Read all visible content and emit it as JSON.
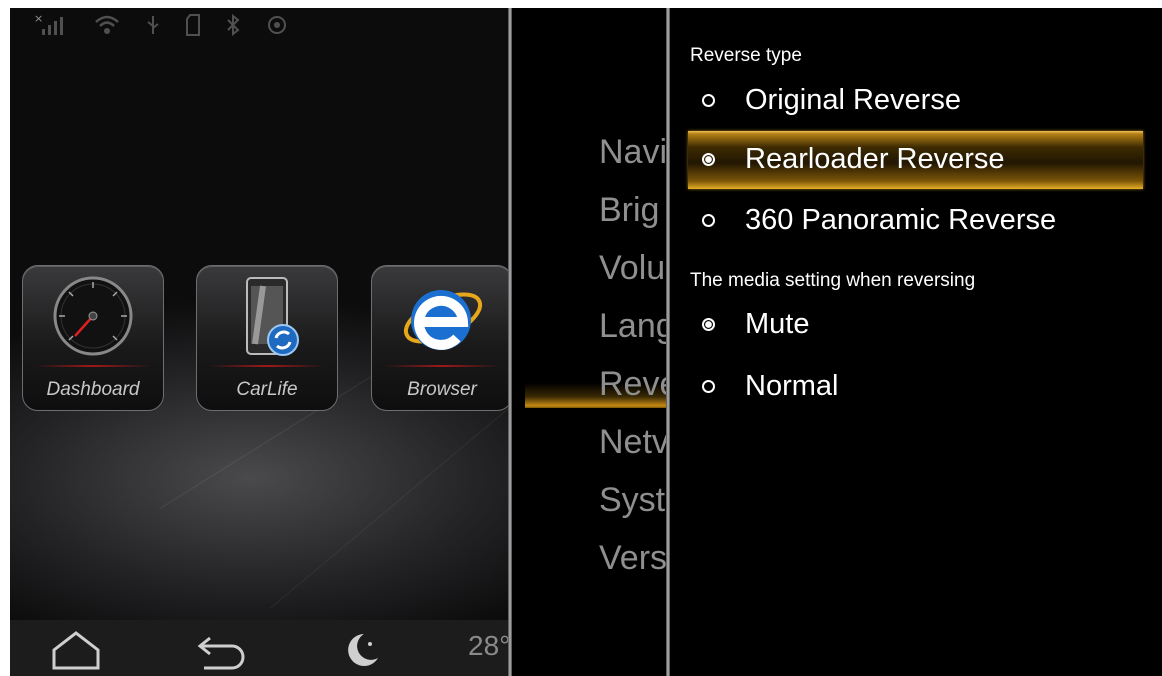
{
  "launcher": {
    "apps": [
      {
        "label": "Dashboard",
        "icon": "speedometer-icon"
      },
      {
        "label": "CarLife",
        "icon": "carlife-phone-icon"
      },
      {
        "label": "Browser",
        "icon": "internet-explorer-icon"
      }
    ],
    "temperature": "28°"
  },
  "menu": {
    "items": [
      "Navi",
      "Brig",
      "Volu",
      "Lang",
      "Reve",
      "Netv",
      "Syst",
      "Vers"
    ],
    "selected_index": 4
  },
  "settings": {
    "reverse_type": {
      "title": "Reverse type",
      "options": [
        "Original Reverse",
        "Rearloader Reverse",
        "360 Panoramic Reverse"
      ],
      "selected_index": 1
    },
    "media_setting": {
      "title": "The media setting when reversing",
      "options": [
        "Mute",
        "Normal"
      ],
      "selected_index": 0
    }
  },
  "colors": {
    "highlight_gold": "#c48a12",
    "menu_text": "#8f8f8f",
    "background": "#000000"
  }
}
